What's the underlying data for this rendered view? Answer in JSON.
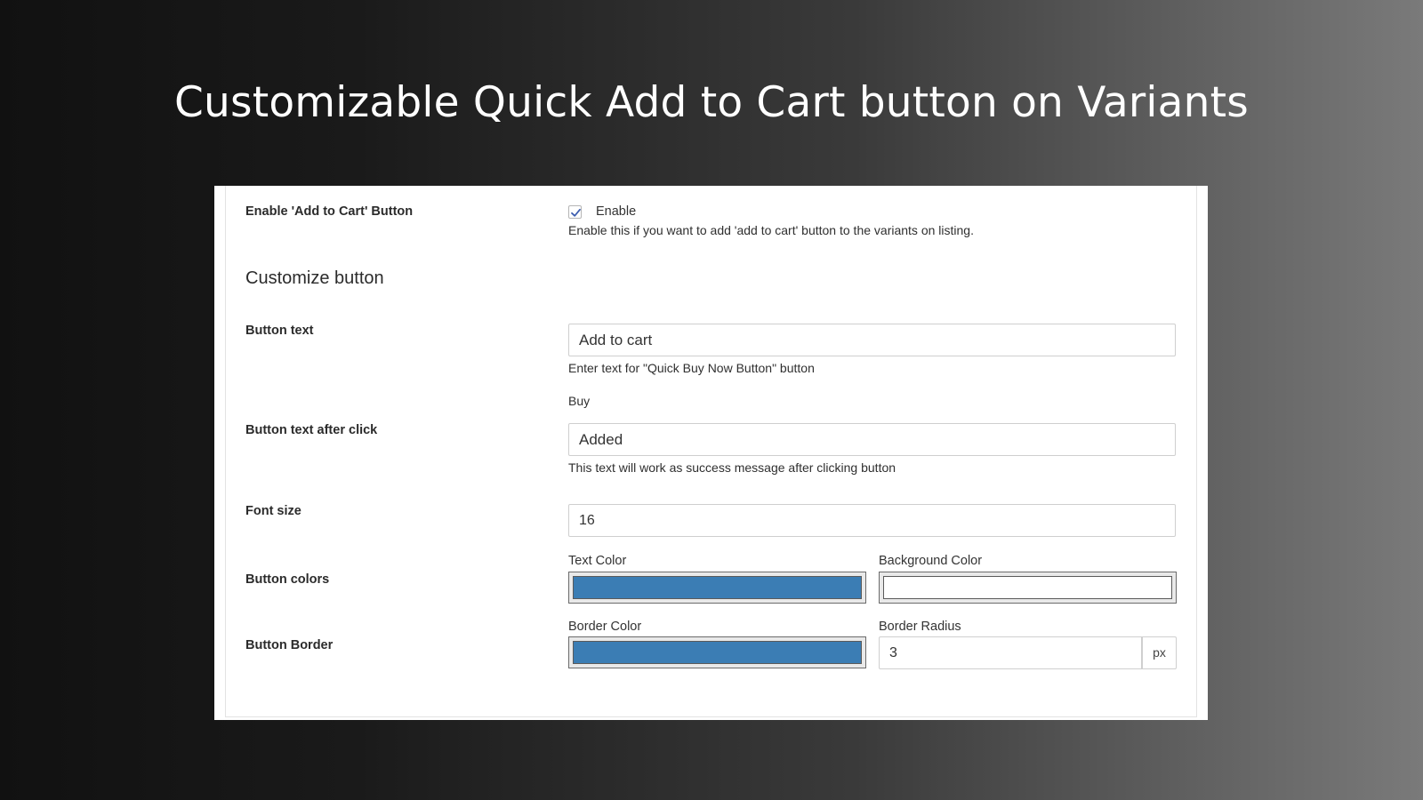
{
  "headline": "Customizable Quick Add to Cart button on Variants",
  "settings": {
    "enable_button": {
      "label": "Enable 'Add to Cart' Button",
      "checkbox_label": "Enable",
      "checked": true,
      "help": "Enable this if you want to add 'add to cart' button to the variants on listing."
    },
    "section_title": "Customize button",
    "button_text": {
      "label": "Button text",
      "value": "Add to cart",
      "help": "Enter text for \"Quick Buy Now Button\" button",
      "extra": "Buy"
    },
    "button_text_after_click": {
      "label": "Button text after click",
      "value": "Added",
      "help": "This text will work as success message after clicking button"
    },
    "font_size": {
      "label": "Font size",
      "value": "16"
    },
    "button_colors": {
      "label": "Button colors",
      "text_color_caption": "Text Color",
      "text_color": "#3b7db4",
      "background_color_caption": "Background Color",
      "background_color": "#ffffff"
    },
    "button_border": {
      "label": "Button Border",
      "border_color_caption": "Border Color",
      "border_color": "#3b7db4",
      "border_radius_caption": "Border Radius",
      "border_radius": "3",
      "border_radius_unit": "px"
    }
  }
}
